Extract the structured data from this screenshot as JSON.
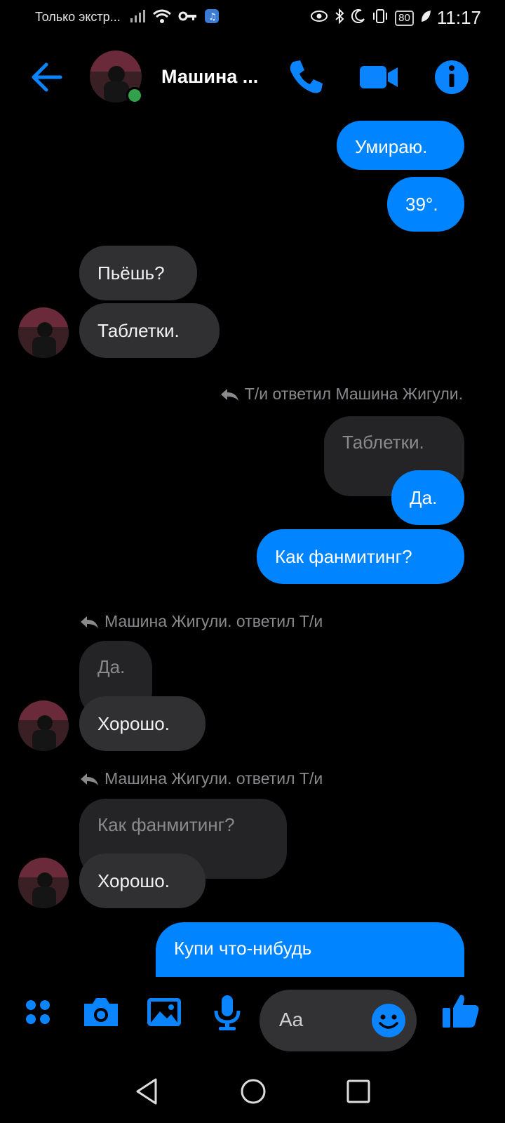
{
  "status_bar": {
    "carrier_text": "Только экстр...",
    "battery": "80",
    "time": "11:17"
  },
  "header": {
    "contact_name": "Машина ...",
    "online": true
  },
  "messages": [
    {
      "type": "out",
      "text": "Умираю."
    },
    {
      "type": "out",
      "text": "39°."
    },
    {
      "type": "in",
      "text": "Пьёшь?"
    },
    {
      "type": "in",
      "text": "Таблетки."
    },
    {
      "type": "reply_note",
      "text": "Т/и ответил Машина Жигули."
    },
    {
      "type": "quote",
      "text": "Таблетки."
    },
    {
      "type": "out",
      "text": "Да."
    },
    {
      "type": "out",
      "text": "Как фанмитинг?"
    },
    {
      "type": "reply_note",
      "text": "Машина Жигули. ответил Т/и"
    },
    {
      "type": "quote",
      "text": "Да."
    },
    {
      "type": "in",
      "text": "Хорошо."
    },
    {
      "type": "reply_note",
      "text": "Машина Жигули. ответил Т/и"
    },
    {
      "type": "quote",
      "text": "Как фанмитинг?"
    },
    {
      "type": "in",
      "text": "Хорошо."
    },
    {
      "type": "out",
      "text": "Купи что-нибудь"
    }
  ],
  "composer": {
    "placeholder": "Aa"
  },
  "colors": {
    "accent": "#0084ff",
    "incoming_bubble": "#303033",
    "quote_bubble": "#242426",
    "background": "#000000"
  },
  "icons": [
    "back-arrow-icon",
    "phone-icon",
    "video-icon",
    "info-icon",
    "apps-icon",
    "camera-icon",
    "gallery-icon",
    "microphone-icon",
    "emoji-icon",
    "like-icon",
    "nav-back-icon",
    "nav-home-icon",
    "nav-recents-icon"
  ]
}
